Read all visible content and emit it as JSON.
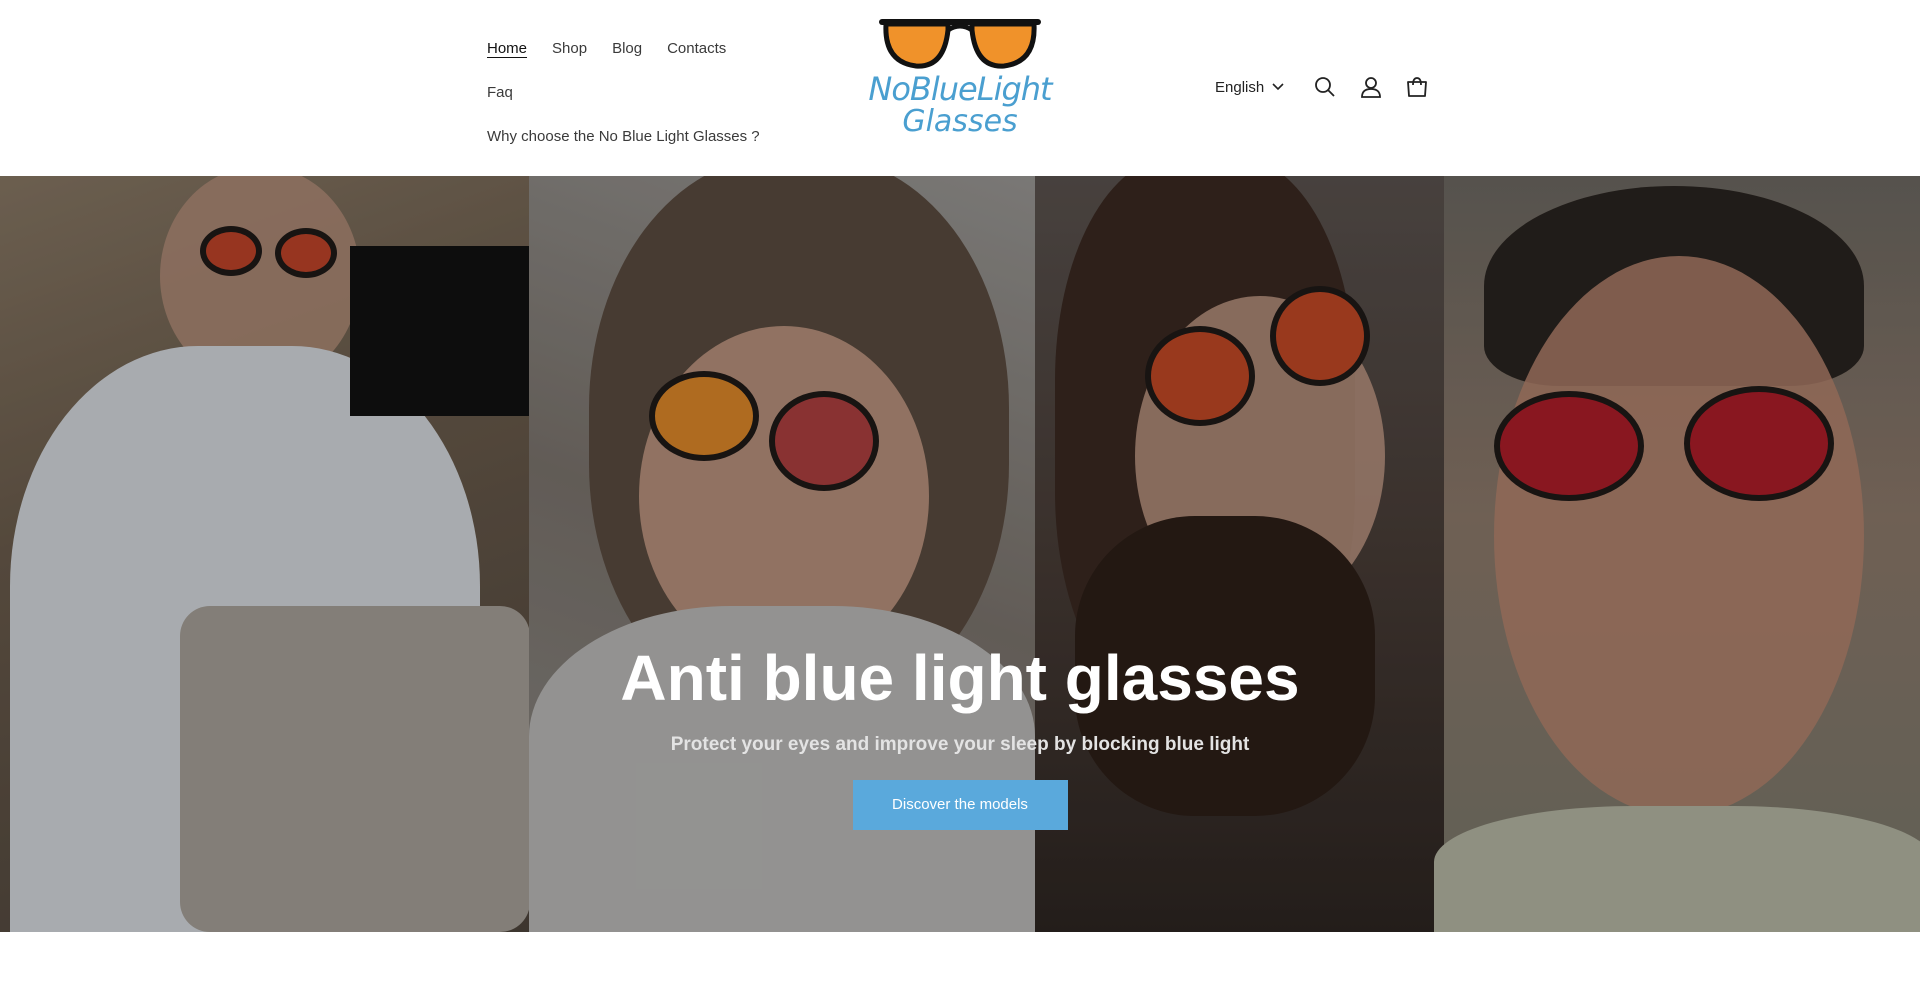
{
  "nav": {
    "items": [
      {
        "label": "Home",
        "active": true
      },
      {
        "label": "Shop"
      },
      {
        "label": "Blog"
      },
      {
        "label": "Contacts"
      },
      {
        "label": "Faq"
      },
      {
        "label": "Why choose the No Blue Light Glasses ?"
      }
    ]
  },
  "logo": {
    "line1": "NoBlueLight",
    "line2": "Glasses",
    "icon": "glasses-logo-icon"
  },
  "header": {
    "language": "English",
    "icons": [
      "search-icon",
      "account-icon",
      "cart-icon"
    ]
  },
  "hero": {
    "title": "Anti blue light glasses",
    "subtitle": "Protect your eyes and improve your sleep by blocking blue light",
    "cta_label": "Discover the models"
  },
  "colors": {
    "brand_blue": "#4a9fd0",
    "button_blue": "#5aa9dc",
    "lens_orange": "#f0922a"
  }
}
